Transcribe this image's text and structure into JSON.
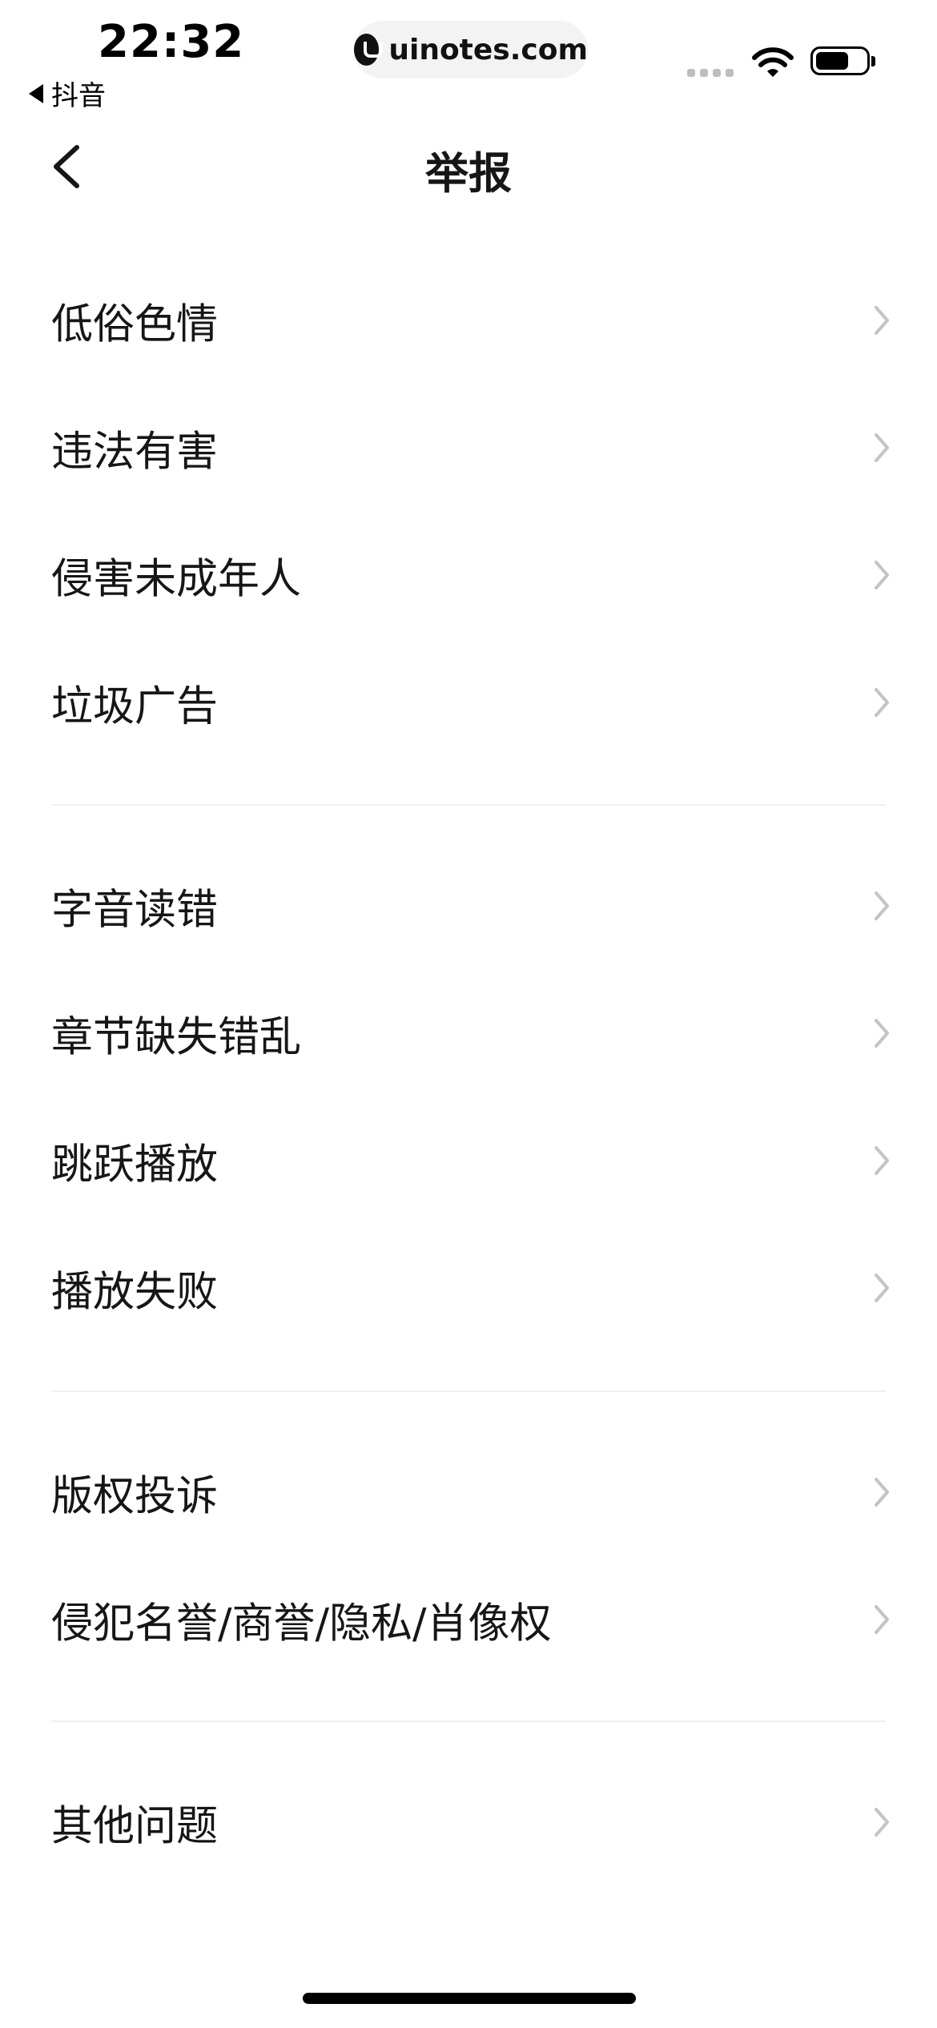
{
  "status_bar": {
    "time": "22:32",
    "back_app": "抖音",
    "url": "uinotes.com"
  },
  "nav": {
    "title": "举报",
    "back_icon": "chevron-left-icon"
  },
  "groups": [
    {
      "items": [
        "低俗色情",
        "违法有害",
        "侵害未成年人",
        "垃圾广告"
      ]
    },
    {
      "items": [
        "字音读错",
        "章节缺失错乱",
        "跳跃播放",
        "播放失败"
      ]
    },
    {
      "items": [
        "版权投诉",
        "侵犯名誉/商誉/隐私/肖像权"
      ]
    },
    {
      "items": [
        "其他问题"
      ]
    }
  ],
  "icons": {
    "row_arrow": "chevron-right-icon"
  },
  "colors": {
    "text": "#161616",
    "chevron": "#c4c4c4",
    "divider": "#f0f0f0",
    "background": "#ffffff"
  }
}
